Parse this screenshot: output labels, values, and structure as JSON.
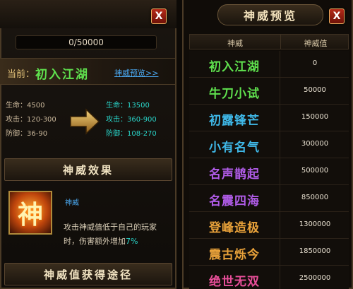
{
  "left": {
    "close_label": "X",
    "progress": {
      "text": "0/50000",
      "fraction": 0
    },
    "current": {
      "label": "当前：",
      "value": "初入江湖",
      "link": "神威预览>>"
    },
    "stats_current": [
      {
        "label": "生命：",
        "value": "4500"
      },
      {
        "label": "攻击：",
        "value": "120-300"
      },
      {
        "label": "防御：",
        "value": "36-90"
      }
    ],
    "stats_next": [
      {
        "label": "生命：",
        "value": "13500"
      },
      {
        "label": "攻击：",
        "value": "360-900"
      },
      {
        "label": "防御：",
        "value": "108-270"
      }
    ],
    "effect_title": "神威效果",
    "effect_icon_char": "神",
    "effect_name": "神威",
    "effect_desc_main": "攻击神威值低于自己的玩家时，伤害额外增加",
    "effect_desc_pct": "7%",
    "route_title": "神威值获得途径"
  },
  "right": {
    "close_label": "X",
    "title": "神威预览",
    "headers": {
      "name": "神威",
      "value": "神威值"
    },
    "ranks": [
      {
        "name": "初入江湖",
        "value": "0",
        "color": "#5fe14e"
      },
      {
        "name": "牛刀小试",
        "value": "50000",
        "color": "#5fe14e"
      },
      {
        "name": "初露锋芒",
        "value": "150000",
        "color": "#3fb8e8"
      },
      {
        "name": "小有名气",
        "value": "300000",
        "color": "#3fb8e8"
      },
      {
        "name": "名声鹊起",
        "value": "500000",
        "color": "#b05ce8"
      },
      {
        "name": "名震四海",
        "value": "850000",
        "color": "#b05ce8"
      },
      {
        "name": "登峰造极",
        "value": "1300000",
        "color": "#e9a23a"
      },
      {
        "name": "震古烁今",
        "value": "1850000",
        "color": "#e9a23a"
      },
      {
        "name": "绝世无双",
        "value": "2500000",
        "color": "#e94f9a"
      }
    ]
  },
  "colors": {
    "accent_green": "#5fe14e",
    "accent_cyan": "#29d4c8",
    "link_blue": "#4aa8f0",
    "close_red": "#b52a18"
  }
}
